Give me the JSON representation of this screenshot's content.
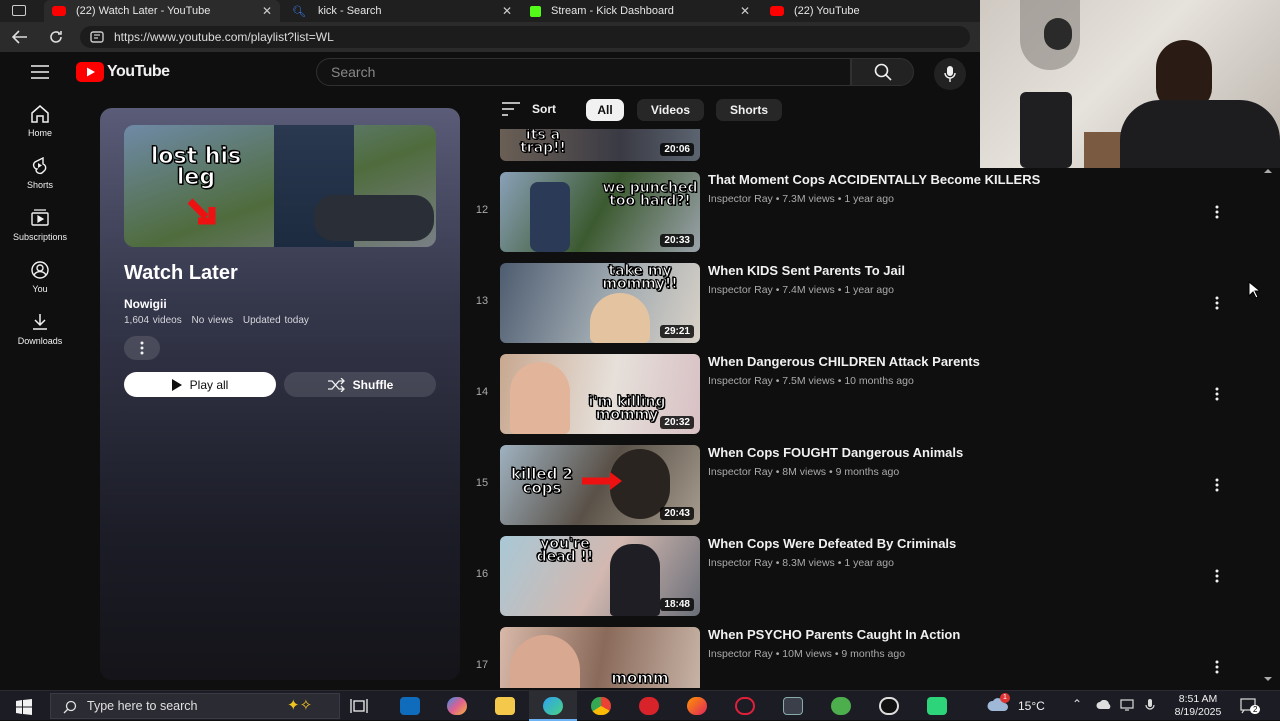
{
  "browser": {
    "tabs": [
      {
        "label": "(22) Watch Later - YouTube",
        "active": true,
        "favicon_color": "#ff0000"
      },
      {
        "label": "kick - Search",
        "active": false,
        "favicon_color": "#3b82f6"
      },
      {
        "label": "Stream - Kick Dashboard",
        "active": false,
        "favicon_color": "#53fc18"
      },
      {
        "label": "(22) YouTube",
        "active": false,
        "favicon_color": "#ff0000"
      }
    ],
    "url": "https://www.youtube.com/playlist?list=WL"
  },
  "youtube": {
    "logo_text": "YouTube",
    "search_placeholder": "Search",
    "nav": [
      {
        "label": "Home",
        "icon": "home-icon"
      },
      {
        "label": "Shorts",
        "icon": "shorts-icon"
      },
      {
        "label": "Subscriptions",
        "icon": "subscriptions-icon"
      },
      {
        "label": "You",
        "icon": "you-icon"
      },
      {
        "label": "Downloads",
        "icon": "download-icon"
      }
    ],
    "playlist": {
      "thumb_text": "lost his leg",
      "title": "Watch Later",
      "owner": "Nowigii",
      "video_count": "1,604 videos",
      "views": "No views",
      "updated": "Updated today",
      "play_all": "Play all",
      "shuffle": "Shuffle"
    },
    "sort_label": "Sort",
    "chips": [
      {
        "label": "All",
        "active": true
      },
      {
        "label": "Videos",
        "active": false
      },
      {
        "label": "Shorts",
        "active": false
      }
    ],
    "partial_video": {
      "thumb_text": "its a trap!!",
      "duration": "20:06"
    },
    "videos": [
      {
        "index": "12",
        "title": "That Moment Cops ACCIDENTALLY Become KILLERS",
        "channel": "Inspector Ray",
        "views": "7.3M views",
        "age": "1 year ago",
        "duration": "20:33",
        "thumb_text": "we punched too hard?!"
      },
      {
        "index": "13",
        "title": "When KIDS Sent Parents To Jail",
        "channel": "Inspector Ray",
        "views": "7.4M views",
        "age": "1 year ago",
        "duration": "29:21",
        "thumb_text": "take my mommy!!"
      },
      {
        "index": "14",
        "title": "When Dangerous CHILDREN Attack Parents",
        "channel": "Inspector Ray",
        "views": "7.5M views",
        "age": "10 months ago",
        "duration": "20:32",
        "thumb_text": "i'm killing mommy"
      },
      {
        "index": "15",
        "title": "When Cops FOUGHT Dangerous Animals",
        "channel": "Inspector Ray",
        "views": "8M views",
        "age": "9 months ago",
        "duration": "20:43",
        "thumb_text": "killed 2 cops"
      },
      {
        "index": "16",
        "title": "When Cops Were Defeated By Criminals",
        "channel": "Inspector Ray",
        "views": "8.3M views",
        "age": "1 year ago",
        "duration": "18:48",
        "thumb_text": "you're dead !!"
      },
      {
        "index": "17",
        "title": "When PSYCHO Parents Caught In Action",
        "channel": "Inspector Ray",
        "views": "10M views",
        "age": "9 months ago",
        "duration": "",
        "thumb_text": "momm"
      }
    ]
  },
  "taskbar": {
    "search_placeholder": "Type here to search",
    "weather_temp": "15°C",
    "time": "8:51 AM",
    "date": "8/19/2025",
    "notification_count": "2"
  }
}
